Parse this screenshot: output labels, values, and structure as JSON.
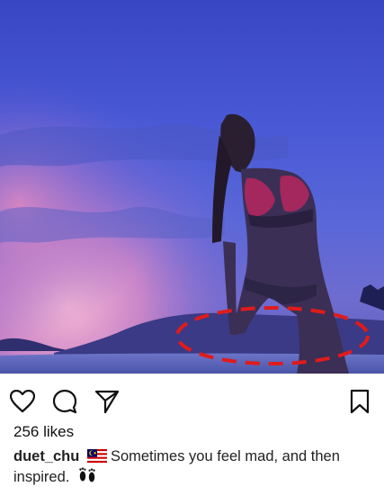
{
  "post": {
    "image_alt": "",
    "likes_text": "256 likes",
    "username": "duet_chu",
    "caption_text": "Sometimes you feel mad, and then inspired.",
    "flag_icon": "malaysia-flag-icon",
    "feet_icon": "footprints-icon"
  },
  "actions": {
    "like_icon": "heart-icon",
    "comment_icon": "comment-bubble-icon",
    "share_icon": "paper-plane-icon",
    "save_icon": "bookmark-icon"
  },
  "colors": {
    "highlight_ellipse": "#e01b1b",
    "sky_top": "#3b4fc7",
    "sunset": "#e48bbd"
  }
}
